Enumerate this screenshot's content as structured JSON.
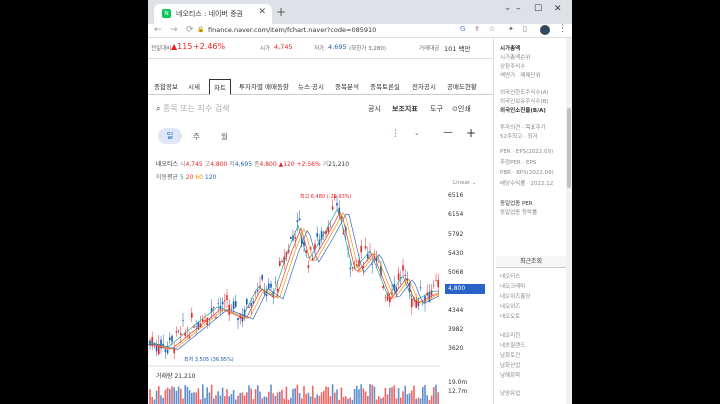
{
  "browser": {
    "tab_title": "네오티스 : 네이버 증권",
    "favicon_label": "N",
    "url": "finance.naver.com/item/fchart.naver?code=085910"
  },
  "ticker": {
    "prev_label": "전일대비",
    "change": "▲115",
    "change_pct": "+2.46%",
    "open_label": "시가",
    "open": "4,745",
    "low_label": "저가",
    "low": "4,695",
    "low_extra": "(하한가 3,280)",
    "value_label": "거래대금",
    "value": "101 백만"
  },
  "menu": [
    "종합정보",
    "시세",
    "차트",
    "투자자별 매매동향",
    "뉴스·공시",
    "종목분석",
    "종목토론실",
    "전자공시",
    "공매도현황"
  ],
  "search_placeholder": "종목 또는 지수 검색",
  "tools": {
    "notice": "공시",
    "indicator": "보조지표",
    "tool": "도구",
    "print": "인쇄"
  },
  "periods": {
    "selected": "일",
    "week": "주",
    "month": "월"
  },
  "info_line": {
    "name": "네오티스",
    "o_label": "시",
    "o": "4,745",
    "h_label": "고",
    "h": "4,800",
    "l_label": "저",
    "l": "4,695",
    "c_label": "종",
    "c": "4,800",
    "chg": "▲120",
    "pct": "+2.56%",
    "v_label": "거",
    "v": "21,210"
  },
  "ma_line": {
    "label": "이동평균",
    "p5": "5",
    "p20": "20",
    "p60": "60",
    "p120": "120"
  },
  "scale_label": "Linear",
  "chart_data": {
    "type": "candlestick",
    "title": "",
    "y_ticks": [
      6516,
      6154,
      5792,
      5430,
      5068,
      4706,
      4344,
      3982,
      3620
    ],
    "current_price": "4,800",
    "max_label": "최고 6,480 (-25.93%)",
    "min_label": "최저 3,505 (36.95%)",
    "volume_label": "거래량",
    "volume_value": "21,210",
    "vol_ticks": [
      "19.0m",
      "12.7m"
    ]
  },
  "sidebar": {
    "items": [
      "시가총액",
      "시가총액순위",
      "상장주식수",
      "액면가 · 매매단위",
      "외국인한도주식수(A)",
      "외국인보유주식수(B)",
      "외국인소진율(B/A)",
      "투자의견 · 목표주가",
      "52주최고 · 최저",
      "PER · EPS(2022.09)",
      "추정PER · EPS",
      "PBR · BPS(2022.09)",
      "배당수익률 · 2022.12",
      "동일업종 PER",
      "동일업종 등락률"
    ],
    "recent_title": "최근조회",
    "recent": [
      "네오티스",
      "네오크레마",
      "네오위즈홀딩",
      "네오위즈",
      "네오오토",
      "네오리진",
      "네츠필랜드",
      "남화토건",
      "남화산업",
      "남해화학",
      "남양유업"
    ]
  },
  "colors": {
    "up": "#e22",
    "down": "#1a5fb4",
    "accent": "#03c75a"
  }
}
